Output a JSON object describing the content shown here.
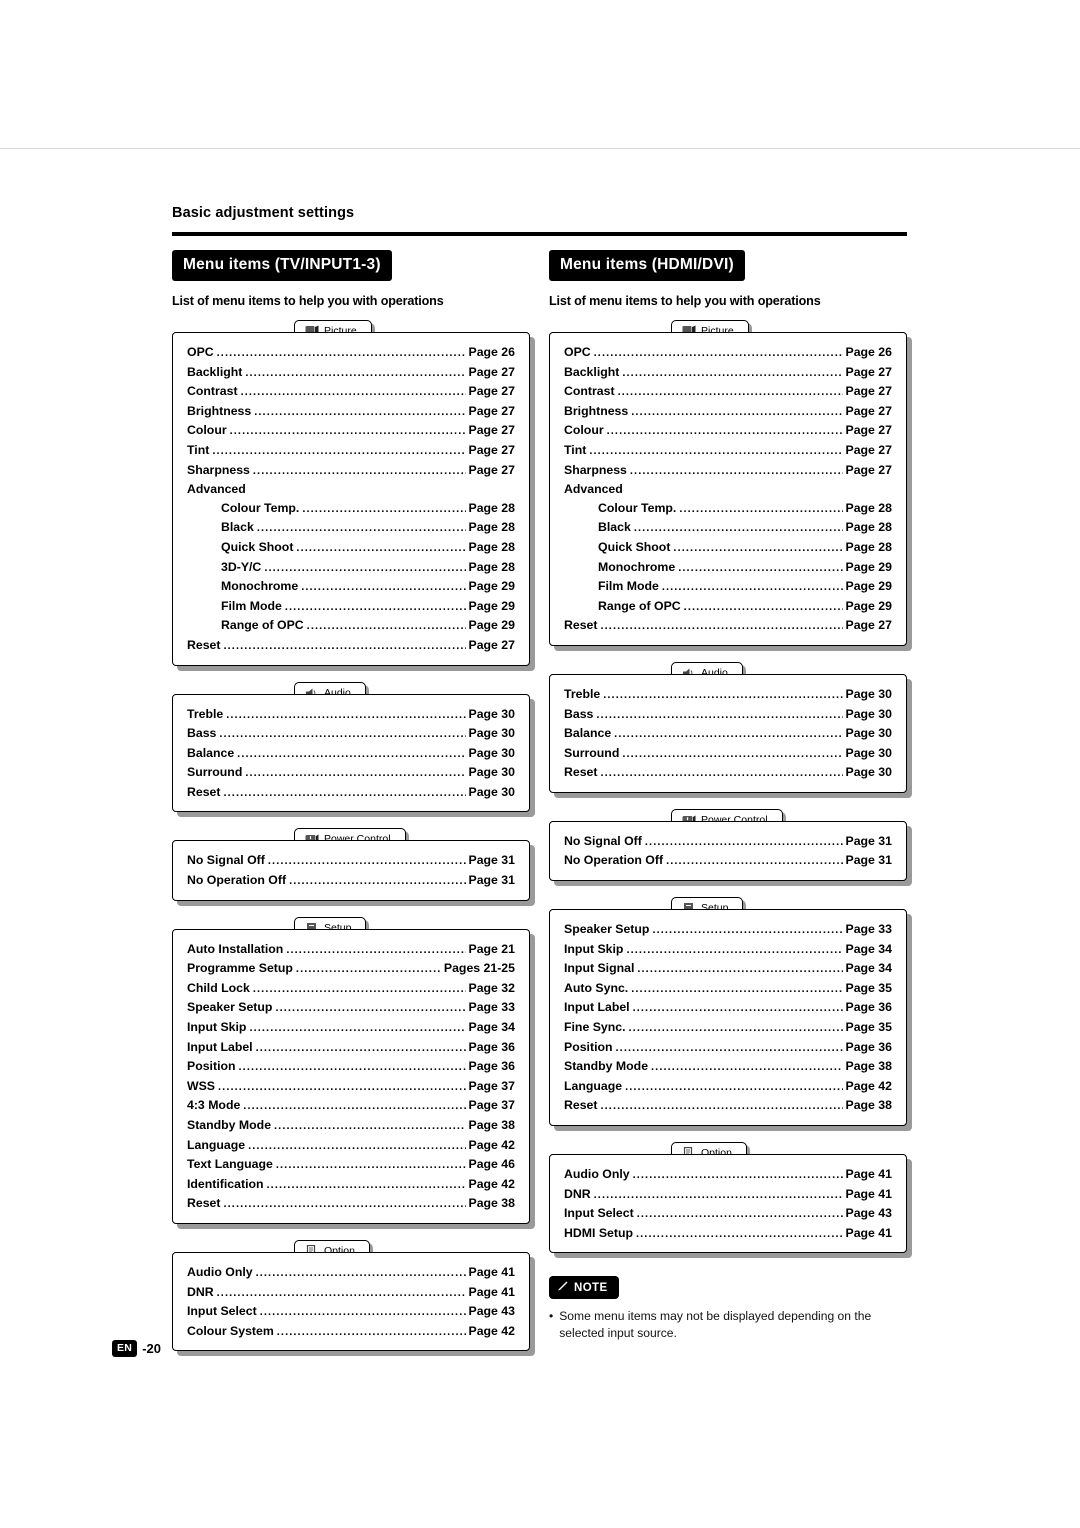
{
  "breadcrumb": "Basic adjustment settings",
  "footer": {
    "lang_badge": "EN",
    "page_number": "-20"
  },
  "note": {
    "label": "NOTE",
    "bullet": "•",
    "text": "Some menu items may not be displayed depending on the selected input source."
  },
  "columns": [
    {
      "title": "Menu items (TV/INPUT1-3)",
      "subtitle": "List of menu items to help you with operations",
      "sections": [
        {
          "tab": "Picture",
          "tab_icon": "picture-icon",
          "rows": [
            {
              "label": "OPC",
              "page": "Page 26",
              "indent": false,
              "dots": true
            },
            {
              "label": "Backlight",
              "page": "Page 27",
              "indent": false,
              "dots": true
            },
            {
              "label": "Contrast",
              "page": "Page 27",
              "indent": false,
              "dots": true
            },
            {
              "label": "Brightness",
              "page": "Page 27",
              "indent": false,
              "dots": true
            },
            {
              "label": "Colour",
              "page": "Page 27",
              "indent": false,
              "dots": true
            },
            {
              "label": "Tint",
              "page": "Page 27",
              "indent": false,
              "dots": true
            },
            {
              "label": "Sharpness",
              "page": "Page 27",
              "indent": false,
              "dots": true
            },
            {
              "label": "Advanced",
              "page": "",
              "indent": false,
              "dots": false
            },
            {
              "label": "Colour Temp.",
              "page": "Page 28",
              "indent": true,
              "dots": true
            },
            {
              "label": "Black",
              "page": "Page 28",
              "indent": true,
              "dots": true
            },
            {
              "label": "Quick Shoot",
              "page": "Page 28",
              "indent": true,
              "dots": true
            },
            {
              "label": "3D-Y/C",
              "page": "Page 28",
              "indent": true,
              "dots": true
            },
            {
              "label": "Monochrome",
              "page": "Page 29",
              "indent": true,
              "dots": true
            },
            {
              "label": "Film Mode",
              "page": "Page 29",
              "indent": true,
              "dots": true
            },
            {
              "label": "Range of OPC",
              "page": "Page 29",
              "indent": true,
              "dots": true
            },
            {
              "label": "Reset",
              "page": "Page 27",
              "indent": false,
              "dots": true
            }
          ]
        },
        {
          "tab": "Audio",
          "tab_icon": "audio-icon",
          "rows": [
            {
              "label": "Treble",
              "page": "Page 30",
              "indent": false,
              "dots": true
            },
            {
              "label": "Bass",
              "page": "Page 30",
              "indent": false,
              "dots": true
            },
            {
              "label": "Balance",
              "page": "Page 30",
              "indent": false,
              "dots": true
            },
            {
              "label": "Surround",
              "page": "Page 30",
              "indent": false,
              "dots": true
            },
            {
              "label": "Reset",
              "page": "Page 30",
              "indent": false,
              "dots": true
            }
          ]
        },
        {
          "tab": "Power Control",
          "tab_icon": "power-control-icon",
          "rows": [
            {
              "label": "No Signal Off",
              "page": "Page 31",
              "indent": false,
              "dots": true
            },
            {
              "label": "No Operation Off",
              "page": "Page 31",
              "indent": false,
              "dots": true
            }
          ]
        },
        {
          "tab": "Setup",
          "tab_icon": "setup-icon",
          "rows": [
            {
              "label": "Auto Installation",
              "page": "Page 21",
              "indent": false,
              "dots": true
            },
            {
              "label": "Programme Setup",
              "page": "Pages 21-25",
              "indent": false,
              "dots": true
            },
            {
              "label": "Child Lock",
              "page": "Page 32",
              "indent": false,
              "dots": true
            },
            {
              "label": "Speaker Setup",
              "page": "Page 33",
              "indent": false,
              "dots": true
            },
            {
              "label": "Input Skip",
              "page": "Page 34",
              "indent": false,
              "dots": true
            },
            {
              "label": "Input Label",
              "page": "Page 36",
              "indent": false,
              "dots": true
            },
            {
              "label": "Position",
              "page": "Page 36",
              "indent": false,
              "dots": true
            },
            {
              "label": "WSS",
              "page": "Page 37",
              "indent": false,
              "dots": true
            },
            {
              "label": "4:3 Mode",
              "page": "Page 37",
              "indent": false,
              "dots": true
            },
            {
              "label": "Standby Mode",
              "page": "Page 38",
              "indent": false,
              "dots": true
            },
            {
              "label": "Language",
              "page": "Page 42",
              "indent": false,
              "dots": true
            },
            {
              "label": "Text Language",
              "page": "Page 46",
              "indent": false,
              "dots": true
            },
            {
              "label": "Identification",
              "page": "Page 42",
              "indent": false,
              "dots": true
            },
            {
              "label": "Reset",
              "page": "Page 38",
              "indent": false,
              "dots": true
            }
          ]
        },
        {
          "tab": "Option",
          "tab_icon": "option-icon",
          "rows": [
            {
              "label": "Audio Only",
              "page": "Page 41",
              "indent": false,
              "dots": true
            },
            {
              "label": "DNR",
              "page": "Page 41",
              "indent": false,
              "dots": true
            },
            {
              "label": "Input Select",
              "page": "Page 43",
              "indent": false,
              "dots": true
            },
            {
              "label": "Colour System",
              "page": "Page 42",
              "indent": false,
              "dots": true
            }
          ]
        }
      ]
    },
    {
      "title": "Menu items (HDMI/DVI)",
      "subtitle": "List of menu items to help you with operations",
      "sections": [
        {
          "tab": "Picture",
          "tab_icon": "picture-icon",
          "rows": [
            {
              "label": "OPC",
              "page": "Page 26",
              "indent": false,
              "dots": true
            },
            {
              "label": "Backlight",
              "page": "Page 27",
              "indent": false,
              "dots": true
            },
            {
              "label": "Contrast",
              "page": "Page 27",
              "indent": false,
              "dots": true
            },
            {
              "label": "Brightness",
              "page": "Page 27",
              "indent": false,
              "dots": true
            },
            {
              "label": "Colour",
              "page": "Page 27",
              "indent": false,
              "dots": true
            },
            {
              "label": "Tint",
              "page": "Page 27",
              "indent": false,
              "dots": true
            },
            {
              "label": "Sharpness",
              "page": "Page 27",
              "indent": false,
              "dots": true
            },
            {
              "label": "Advanced",
              "page": "",
              "indent": false,
              "dots": false
            },
            {
              "label": "Colour Temp.",
              "page": "Page 28",
              "indent": true,
              "dots": true
            },
            {
              "label": "Black",
              "page": "Page 28",
              "indent": true,
              "dots": true
            },
            {
              "label": "Quick Shoot",
              "page": "Page 28",
              "indent": true,
              "dots": true
            },
            {
              "label": "Monochrome",
              "page": "Page 29",
              "indent": true,
              "dots": true
            },
            {
              "label": "Film Mode",
              "page": "Page 29",
              "indent": true,
              "dots": true
            },
            {
              "label": "Range of OPC",
              "page": "Page 29",
              "indent": true,
              "dots": true
            },
            {
              "label": "Reset",
              "page": "Page 27",
              "indent": false,
              "dots": true
            }
          ]
        },
        {
          "tab": "Audio",
          "tab_icon": "audio-icon",
          "rows": [
            {
              "label": "Treble",
              "page": "Page 30",
              "indent": false,
              "dots": true
            },
            {
              "label": "Bass",
              "page": "Page 30",
              "indent": false,
              "dots": true
            },
            {
              "label": "Balance",
              "page": "Page 30",
              "indent": false,
              "dots": true
            },
            {
              "label": "Surround",
              "page": "Page 30",
              "indent": false,
              "dots": true
            },
            {
              "label": "Reset",
              "page": "Page 30",
              "indent": false,
              "dots": true
            }
          ]
        },
        {
          "tab": "Power Control",
          "tab_icon": "power-control-icon",
          "rows": [
            {
              "label": "No Signal Off",
              "page": "Page 31",
              "indent": false,
              "dots": true
            },
            {
              "label": "No Operation Off",
              "page": "Page 31",
              "indent": false,
              "dots": true
            }
          ]
        },
        {
          "tab": "Setup",
          "tab_icon": "setup-icon",
          "rows": [
            {
              "label": "Speaker Setup",
              "page": "Page 33",
              "indent": false,
              "dots": true
            },
            {
              "label": "Input Skip",
              "page": "Page 34",
              "indent": false,
              "dots": true
            },
            {
              "label": "Input Signal",
              "page": "Page 34",
              "indent": false,
              "dots": true
            },
            {
              "label": "Auto Sync.",
              "page": "Page 35",
              "indent": false,
              "dots": true
            },
            {
              "label": "Input Label",
              "page": "Page 36",
              "indent": false,
              "dots": true
            },
            {
              "label": "Fine Sync.",
              "page": "Page 35",
              "indent": false,
              "dots": true
            },
            {
              "label": "Position",
              "page": "Page 36",
              "indent": false,
              "dots": true
            },
            {
              "label": "Standby Mode",
              "page": "Page 38",
              "indent": false,
              "dots": true
            },
            {
              "label": "Language",
              "page": "Page 42",
              "indent": false,
              "dots": true
            },
            {
              "label": "Reset",
              "page": "Page 38",
              "indent": false,
              "dots": true
            }
          ]
        },
        {
          "tab": "Option",
          "tab_icon": "option-icon",
          "rows": [
            {
              "label": "Audio Only",
              "page": "Page 41",
              "indent": false,
              "dots": true
            },
            {
              "label": "DNR",
              "page": "Page 41",
              "indent": false,
              "dots": true
            },
            {
              "label": "Input Select",
              "page": "Page 43",
              "indent": false,
              "dots": true
            },
            {
              "label": "HDMI Setup",
              "page": "Page 41",
              "indent": false,
              "dots": true
            }
          ]
        }
      ]
    }
  ]
}
